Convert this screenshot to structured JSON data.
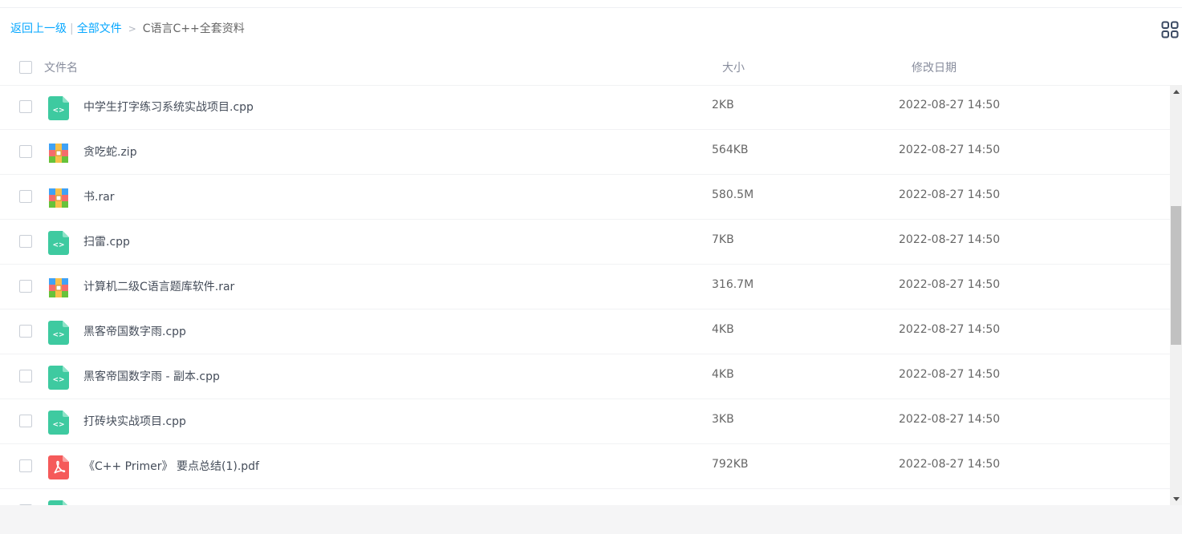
{
  "breadcrumb": {
    "back": "返回上一级",
    "separator": "|",
    "all_files": "全部文件",
    "arrow": ">",
    "current": "C语言C++全套资料"
  },
  "header": {
    "name": "文件名",
    "size": "大小",
    "date": "修改日期"
  },
  "files": [
    {
      "name": "中学生打字练习系统实战项目.cpp",
      "size": "2KB",
      "date": "2022-08-27 14:50",
      "icon": "code-file-icon"
    },
    {
      "name": "贪吃蛇.zip",
      "size": "564KB",
      "date": "2022-08-27 14:50",
      "icon": "archive-icon"
    },
    {
      "name": "书.rar",
      "size": "580.5M",
      "date": "2022-08-27 14:50",
      "icon": "archive-icon"
    },
    {
      "name": "扫雷.cpp",
      "size": "7KB",
      "date": "2022-08-27 14:50",
      "icon": "code-file-icon"
    },
    {
      "name": "计算机二级C语言题库软件.rar",
      "size": "316.7M",
      "date": "2022-08-27 14:50",
      "icon": "archive-icon"
    },
    {
      "name": "黑客帝国数字雨.cpp",
      "size": "4KB",
      "date": "2022-08-27 14:50",
      "icon": "code-file-icon"
    },
    {
      "name": "黑客帝国数字雨 - 副本.cpp",
      "size": "4KB",
      "date": "2022-08-27 14:50",
      "icon": "code-file-icon"
    },
    {
      "name": "打砖块实战项目.cpp",
      "size": "3KB",
      "date": "2022-08-27 14:50",
      "icon": "code-file-icon"
    },
    {
      "name": "《C++ Primer》 要点总结(1).pdf",
      "size": "792KB",
      "date": "2022-08-27 14:50",
      "icon": "pdf-icon"
    },
    {
      "name": "",
      "size": "",
      "date": "",
      "icon": "code-file-icon"
    }
  ],
  "colors": {
    "link": "#06a7ff",
    "code_icon": "#3ecaa0",
    "pdf_icon": "#f55a5a"
  }
}
